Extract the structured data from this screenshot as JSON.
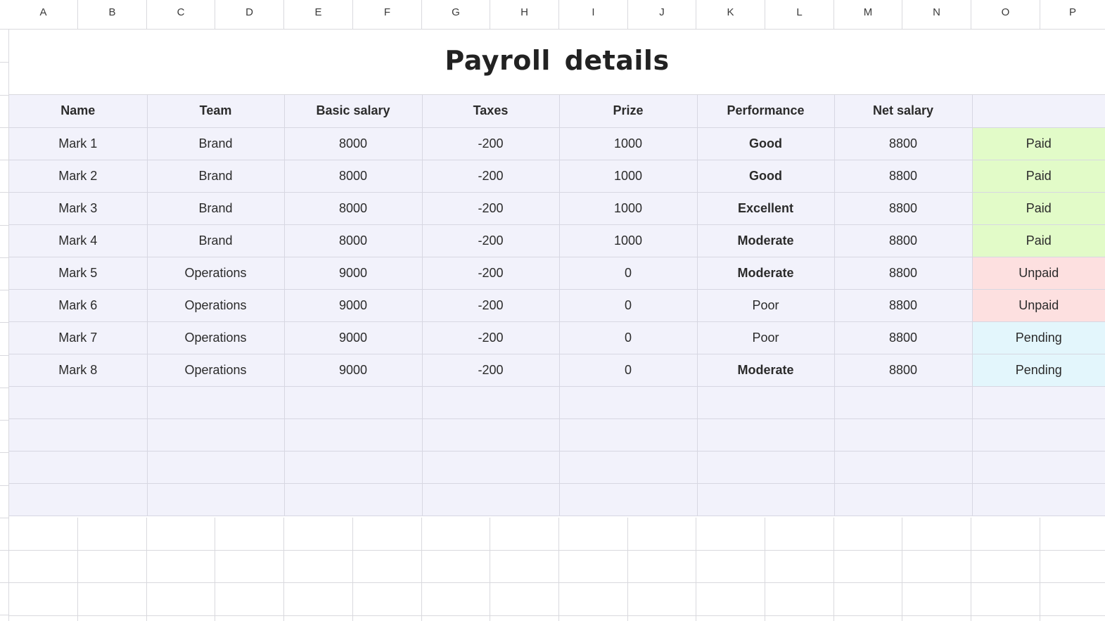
{
  "sheet": {
    "column_letters": [
      "A",
      "B",
      "C",
      "D",
      "E",
      "F",
      "G",
      "H",
      "I",
      "J",
      "K",
      "L",
      "M",
      "N",
      "O",
      "P"
    ],
    "title": "Payroll  details"
  },
  "table": {
    "headers": [
      "Name",
      "Team",
      "Basic salary",
      "Taxes",
      "Prize",
      "Performance",
      "Net salary",
      ""
    ],
    "rows": [
      {
        "name": "Mark 1",
        "team": "Brand",
        "basic": "8000",
        "taxes": "-200",
        "prize": "1000",
        "performance": "Good",
        "net": "8800",
        "status": "Paid"
      },
      {
        "name": "Mark 2",
        "team": "Brand",
        "basic": "8000",
        "taxes": "-200",
        "prize": "1000",
        "performance": "Good",
        "net": "8800",
        "status": "Paid"
      },
      {
        "name": "Mark 3",
        "team": "Brand",
        "basic": "8000",
        "taxes": "-200",
        "prize": "1000",
        "performance": "Excellent",
        "net": "8800",
        "status": "Paid"
      },
      {
        "name": "Mark 4",
        "team": "Brand",
        "basic": "8000",
        "taxes": "-200",
        "prize": "1000",
        "performance": "Moderate",
        "net": "8800",
        "status": "Paid"
      },
      {
        "name": "Mark 5",
        "team": "Operations",
        "basic": "9000",
        "taxes": "-200",
        "prize": "0",
        "performance": "Moderate",
        "net": "8800",
        "status": "Unpaid"
      },
      {
        "name": "Mark 6",
        "team": "Operations",
        "basic": "9000",
        "taxes": "-200",
        "prize": "0",
        "performance": "Poor",
        "net": "8800",
        "status": "Unpaid"
      },
      {
        "name": "Mark 7",
        "team": "Operations",
        "basic": "9000",
        "taxes": "-200",
        "prize": "0",
        "performance": "Poor",
        "net": "8800",
        "status": "Pending"
      },
      {
        "name": "Mark 8",
        "team": "Operations",
        "basic": "9000",
        "taxes": "-200",
        "prize": "0",
        "performance": "Moderate",
        "net": "8800",
        "status": "Pending"
      }
    ]
  },
  "colors": {
    "paid_bg": "#e2fbc8",
    "unpaid_bg": "#fde0e0",
    "pending_bg": "#e3f6fc",
    "negative": "#d62d2d",
    "positive": "#3f8a1c",
    "excellent": "#2a9be0",
    "moderate": "#f0a032",
    "table_bg": "#f2f2fb"
  }
}
